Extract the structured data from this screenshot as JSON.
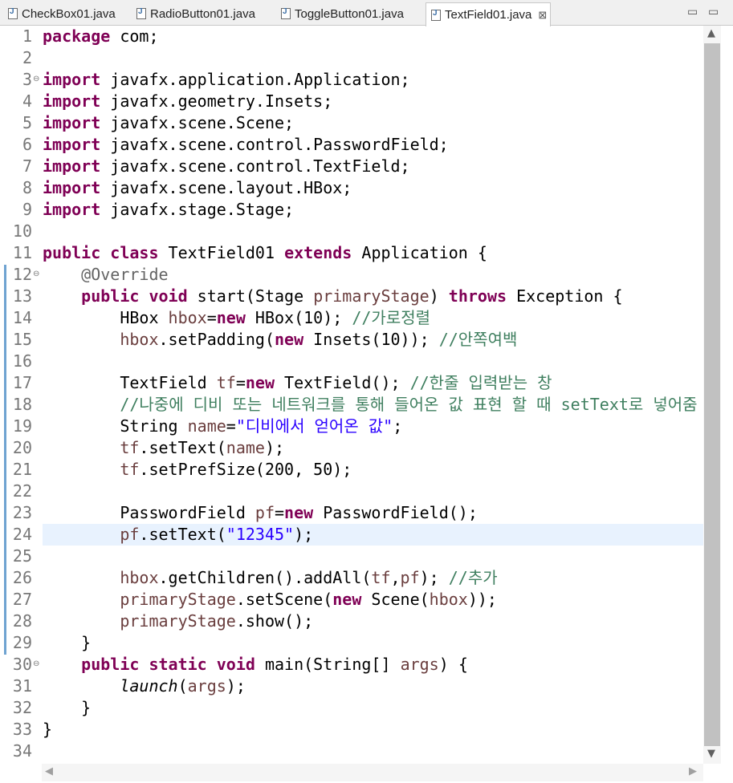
{
  "tabs": [
    {
      "label": "CheckBox01.java",
      "active": false
    },
    {
      "label": "RadioButton01.java",
      "active": false
    },
    {
      "label": "ToggleButton01.java",
      "active": false
    },
    {
      "label": "TextField01.java",
      "active": true,
      "close": "⊠"
    }
  ],
  "window_controls": {
    "minimize": "▭",
    "maximize": "▭"
  },
  "editor": {
    "current_line": 24,
    "line_numbers": [
      "1",
      "2",
      "3",
      "4",
      "5",
      "6",
      "7",
      "8",
      "9",
      "10",
      "11",
      "12",
      "13",
      "14",
      "15",
      "16",
      "17",
      "18",
      "19",
      "20",
      "21",
      "22",
      "23",
      "24",
      "25",
      "26",
      "27",
      "28",
      "29",
      "30",
      "31",
      "32",
      "33",
      "34"
    ],
    "fold_markers": {
      "3": "⊖",
      "12": "⊖",
      "30": "⊖"
    },
    "code": {
      "l1_kw": "package",
      "l1_rest": " com;",
      "l3_kw": "import",
      "l3_rest": " javafx.application.Application;",
      "l4_kw": "import",
      "l4_rest": " javafx.geometry.Insets;",
      "l5_kw": "import",
      "l5_rest": " javafx.scene.Scene;",
      "l6_kw": "import",
      "l6_rest": " javafx.scene.control.PasswordField;",
      "l7_kw": "import",
      "l7_rest": " javafx.scene.control.TextField;",
      "l8_kw": "import",
      "l8_rest": " javafx.scene.layout.HBox;",
      "l9_kw": "import",
      "l9_rest": " javafx.stage.Stage;",
      "l11_kw1": "public",
      "l11_kw2": "class",
      "l11_a": " TextField01 ",
      "l11_kw3": "extends",
      "l11_b": " Application {",
      "l12_ann": "    @Override",
      "l13_kw1": "public",
      "l13_kw2": "void",
      "l13_a": " start(Stage ",
      "l13_var": "primaryStage",
      "l13_b": ") ",
      "l13_kw3": "throws",
      "l13_c": " Exception {",
      "l14_a": "        HBox ",
      "l14_var": "hbox",
      "l14_b": "=",
      "l14_kw": "new",
      "l14_c": " HBox(10); ",
      "l14_cm": "//가로정렬",
      "l15_var": "hbox",
      "l15_a": ".setPadding(",
      "l15_kw": "new",
      "l15_b": " Insets(10)); ",
      "l15_cm": "//안쪽여백",
      "l17_a": "        TextField ",
      "l17_var": "tf",
      "l17_b": "=",
      "l17_kw": "new",
      "l17_c": " TextField(); ",
      "l17_cm": "//한줄 입력받는 창",
      "l18_cm": "//나중에 디비 또는 네트워크를 통해 들어온 값 표현 할 때 setText로 넣어줌",
      "l19_a": "        String ",
      "l19_var": "name",
      "l19_b": "=",
      "l19_st": "\"디비에서 얻어온 값\"",
      "l19_c": ";",
      "l20_var": "tf",
      "l20_a": ".setText(",
      "l20_var2": "name",
      "l20_b": ");",
      "l21_var": "tf",
      "l21_a": ".setPrefSize(200, 50);",
      "l23_a": "        PasswordField ",
      "l23_var": "pf",
      "l23_b": "=",
      "l23_kw": "new",
      "l23_c": " PasswordField();",
      "l24_var": "pf",
      "l24_a": ".setText(",
      "l24_st": "\"12345\"",
      "l24_b": ");",
      "l26_var": "hbox",
      "l26_a": ".getChildren().addAll(",
      "l26_var2": "tf",
      "l26_b": ",",
      "l26_var3": "pf",
      "l26_c": "); ",
      "l26_cm": "//추가",
      "l27_var": "primaryStage",
      "l27_a": ".setScene(",
      "l27_kw": "new",
      "l27_b": " Scene(",
      "l27_var2": "hbox",
      "l27_c": "));",
      "l28_var": "primaryStage",
      "l28_a": ".show();",
      "l29": "    }",
      "l30_kw1": "public",
      "l30_kw2": "static",
      "l30_kw3": "void",
      "l30_a": " main(String[] ",
      "l30_var": "args",
      "l30_b": ") {",
      "l31_it": "launch",
      "l31_a": "(",
      "l31_var": "args",
      "l31_b": ");",
      "l32": "    }",
      "l33": "}"
    }
  },
  "scrollbar": {
    "up": "▲",
    "down": "▼",
    "left": "◀",
    "right": "▶"
  }
}
